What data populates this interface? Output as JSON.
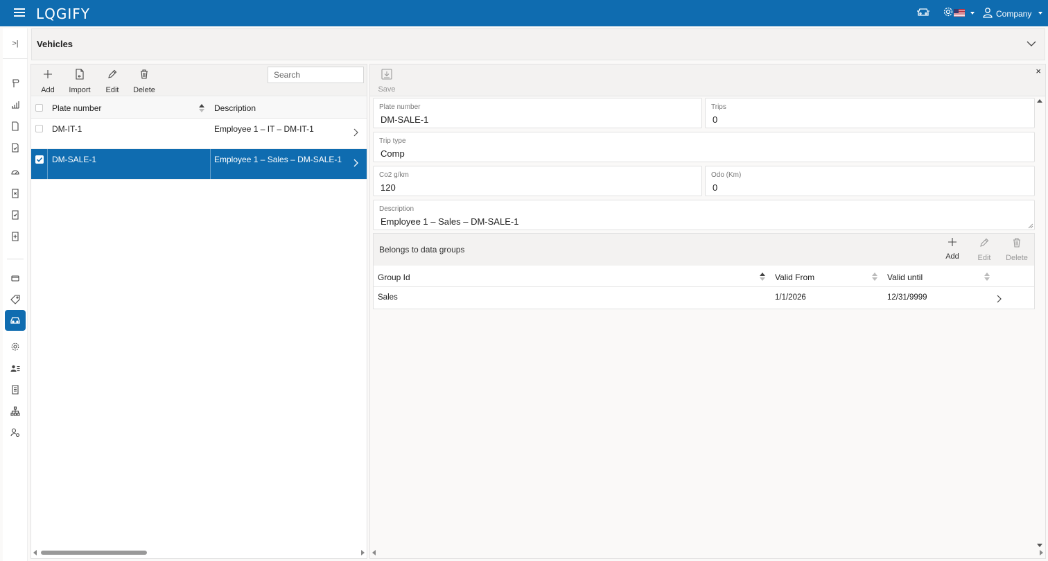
{
  "app": {
    "logo": "LQGIFY"
  },
  "topbar": {
    "company_label": "Company"
  },
  "header": {
    "title": "Vehicles"
  },
  "list_toolbar": {
    "add_label": "Add",
    "import_label": "Import",
    "edit_label": "Edit",
    "delete_label": "Delete",
    "search_placeholder": "Search"
  },
  "grid": {
    "columns": [
      "Plate number",
      "Description"
    ],
    "rows": [
      {
        "plate": "DM-IT-1",
        "description": "Employee 1 – IT – DM-IT-1",
        "selected": false
      },
      {
        "plate": "DM-SALE-1",
        "description": "Employee 1 – Sales – DM-SALE-1",
        "selected": true
      }
    ]
  },
  "detail_toolbar": {
    "save_label": "Save",
    "close_label": "×"
  },
  "form": {
    "plate_label": "Plate number",
    "plate_value": "DM-SALE-1",
    "trips_label": "Trips",
    "trips_value": "0",
    "trip_type_label": "Trip type",
    "trip_type_value": "Comp",
    "co2_label": "Co2 g/km",
    "co2_value": "120",
    "odo_label": "Odo (Km)",
    "odo_value": "0",
    "description_label": "Description",
    "description_value": "Employee 1 – Sales – DM-SALE-1"
  },
  "groups": {
    "title": "Belongs to data groups",
    "add_label": "Add",
    "edit_label": "Edit",
    "delete_label": "Delete",
    "columns": [
      "Group Id",
      "Valid From",
      "Valid until"
    ],
    "rows": [
      {
        "group_id": "Sales",
        "valid_from": "1/1/2026",
        "valid_until": "12/31/9999"
      }
    ]
  },
  "colors": {
    "brand": "#0f6cb0",
    "toolbar_bg": "#f3f2f1"
  }
}
